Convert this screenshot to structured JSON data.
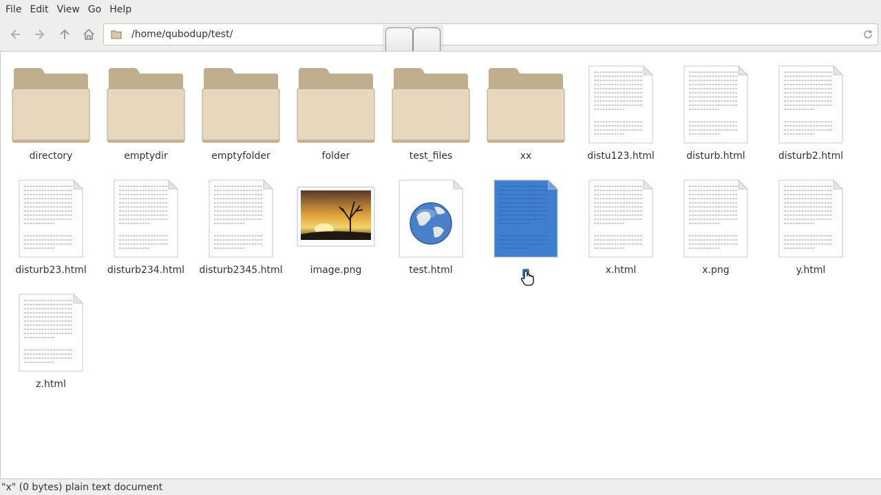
{
  "menu": [
    "File",
    "Edit",
    "View",
    "Go",
    "Help"
  ],
  "toolbar": {
    "back_icon": "back-arrow-icon",
    "forward_icon": "forward-arrow-icon",
    "up_icon": "up-arrow-icon",
    "home_icon": "home-icon",
    "location": "/home/qubodup/test/",
    "reload_icon": "reload-icon"
  },
  "items": [
    {
      "name": "directory",
      "type": "folder"
    },
    {
      "name": "emptydir",
      "type": "folder"
    },
    {
      "name": "emptyfolder",
      "type": "folder"
    },
    {
      "name": "folder",
      "type": "folder"
    },
    {
      "name": "test_files",
      "type": "folder"
    },
    {
      "name": "xx",
      "type": "folder"
    },
    {
      "name": "distu123.html",
      "type": "text"
    },
    {
      "name": "disturb.html",
      "type": "text"
    },
    {
      "name": "disturb2.html",
      "type": "text"
    },
    {
      "name": "disturb23.html",
      "type": "text"
    },
    {
      "name": "disturb234.html",
      "type": "text"
    },
    {
      "name": "disturb2345.html",
      "type": "text"
    },
    {
      "name": "image.png",
      "type": "image"
    },
    {
      "name": "test.html",
      "type": "web"
    },
    {
      "name": "x",
      "type": "text-selected"
    },
    {
      "name": "x.html",
      "type": "text"
    },
    {
      "name": "x.png",
      "type": "text"
    },
    {
      "name": "y.html",
      "type": "text"
    },
    {
      "name": "z.html",
      "type": "text"
    }
  ],
  "status": "\"x\" (0 bytes) plain text document",
  "colors": {
    "folder_body": "#e7d8bd",
    "folder_tab": "#bfae8e",
    "selection": "#3f7fcf"
  }
}
